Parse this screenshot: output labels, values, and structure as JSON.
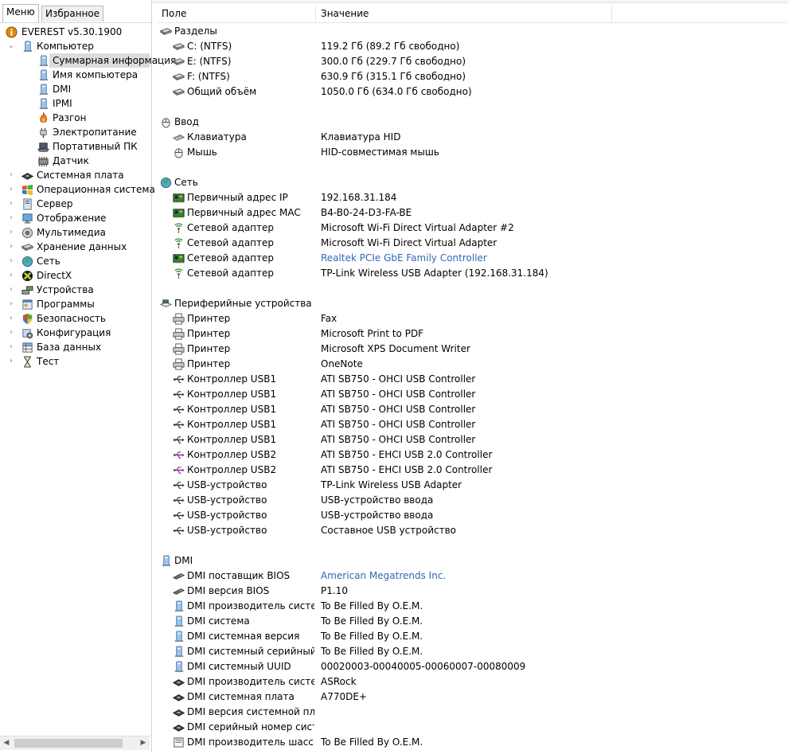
{
  "tabs": {
    "menu": "Меню",
    "favorites": "Избранное"
  },
  "tree": [
    {
      "label": "EVEREST v5.30.1900",
      "level": 0,
      "icon": "info-icon",
      "expander": ""
    },
    {
      "label": "Компьютер",
      "level": 0,
      "icon": "computer-icon",
      "expander": "open"
    },
    {
      "label": "Суммарная информация",
      "level": 1,
      "icon": "computer-icon",
      "expander": "",
      "selected": true
    },
    {
      "label": "Имя компьютера",
      "level": 1,
      "icon": "computer-icon",
      "expander": ""
    },
    {
      "label": "DMI",
      "level": 1,
      "icon": "computer-icon",
      "expander": ""
    },
    {
      "label": "IPMI",
      "level": 1,
      "icon": "computer-icon",
      "expander": ""
    },
    {
      "label": "Разгон",
      "level": 1,
      "icon": "flame-icon",
      "expander": ""
    },
    {
      "label": "Электропитание",
      "level": 1,
      "icon": "power-plug-icon",
      "expander": ""
    },
    {
      "label": "Портативный ПК",
      "level": 1,
      "icon": "laptop-icon",
      "expander": ""
    },
    {
      "label": "Датчик",
      "level": 1,
      "icon": "sensor-icon",
      "expander": ""
    },
    {
      "label": "Системная плата",
      "level": 0,
      "icon": "motherboard-icon",
      "expander": "closed"
    },
    {
      "label": "Операционная система",
      "level": 0,
      "icon": "windows-icon",
      "expander": "closed"
    },
    {
      "label": "Сервер",
      "level": 0,
      "icon": "server-icon",
      "expander": "closed"
    },
    {
      "label": "Отображение",
      "level": 0,
      "icon": "monitor-icon",
      "expander": "closed"
    },
    {
      "label": "Мультимедиа",
      "level": 0,
      "icon": "speaker-icon",
      "expander": "closed"
    },
    {
      "label": "Хранение данных",
      "level": 0,
      "icon": "disk-icon",
      "expander": "closed"
    },
    {
      "label": "Сеть",
      "level": 0,
      "icon": "network-globe-icon",
      "expander": "closed"
    },
    {
      "label": "DirectX",
      "level": 0,
      "icon": "directx-icon",
      "expander": "closed"
    },
    {
      "label": "Устройства",
      "level": 0,
      "icon": "devices-icon",
      "expander": "closed"
    },
    {
      "label": "Программы",
      "level": 0,
      "icon": "programs-icon",
      "expander": "closed"
    },
    {
      "label": "Безопасность",
      "level": 0,
      "icon": "shield-icon",
      "expander": "closed"
    },
    {
      "label": "Конфигурация",
      "level": 0,
      "icon": "config-icon",
      "expander": "closed"
    },
    {
      "label": "База данных",
      "level": 0,
      "icon": "database-icon",
      "expander": "closed"
    },
    {
      "label": "Тест",
      "level": 0,
      "icon": "hourglass-icon",
      "expander": "closed"
    }
  ],
  "columns": {
    "field": "Поле",
    "value": "Значение"
  },
  "rows": [
    {
      "type": "group",
      "field": "Разделы",
      "icon": "disk-group-icon"
    },
    {
      "type": "item",
      "field": "C: (NTFS)",
      "value": "119.2 Гб (89.2 Гб свободно)",
      "icon": "disk-icon"
    },
    {
      "type": "item",
      "field": "E: (NTFS)",
      "value": "300.0 Гб (229.7 Гб свободно)",
      "icon": "disk-icon"
    },
    {
      "type": "item",
      "field": "F: (NTFS)",
      "value": "630.9 Гб (315.1 Гб свободно)",
      "icon": "disk-icon"
    },
    {
      "type": "item",
      "field": "Общий объём",
      "value": "1050.0 Гб (634.0 Гб свободно)",
      "icon": "disk-icon"
    },
    {
      "type": "blank"
    },
    {
      "type": "group",
      "field": "Ввод",
      "icon": "mouse-group-icon"
    },
    {
      "type": "item",
      "field": "Клавиатура",
      "value": "Клавиатура HID",
      "icon": "keyboard-icon"
    },
    {
      "type": "item",
      "field": "Мышь",
      "value": "HID-совместимая мышь",
      "icon": "mouse-icon"
    },
    {
      "type": "blank"
    },
    {
      "type": "group",
      "field": "Сеть",
      "icon": "network-globe-icon"
    },
    {
      "type": "item",
      "field": "Первичный адрес IP",
      "value": "192.168.31.184",
      "icon": "network-card-icon"
    },
    {
      "type": "item",
      "field": "Первичный адрес MAC",
      "value": "B4-B0-24-D3-FA-BE",
      "icon": "network-card-icon"
    },
    {
      "type": "item",
      "field": "Сетевой адаптер",
      "value": "Microsoft Wi-Fi Direct Virtual Adapter #2",
      "icon": "wifi-icon"
    },
    {
      "type": "item",
      "field": "Сетевой адаптер",
      "value": "Microsoft Wi-Fi Direct Virtual Adapter",
      "icon": "wifi-icon"
    },
    {
      "type": "item",
      "field": "Сетевой адаптер",
      "value": "Realtek PCIe GbE Family Controller",
      "icon": "network-card-icon",
      "link": true
    },
    {
      "type": "item",
      "field": "Сетевой адаптер",
      "value": "TP-Link Wireless USB Adapter  (192.168.31.184)",
      "icon": "wifi-icon"
    },
    {
      "type": "blank"
    },
    {
      "type": "group",
      "field": "Периферийные устройства",
      "icon": "peripherals-icon"
    },
    {
      "type": "item",
      "field": "Принтер",
      "value": "Fax",
      "icon": "printer-icon"
    },
    {
      "type": "item",
      "field": "Принтер",
      "value": "Microsoft Print to PDF",
      "icon": "printer-icon"
    },
    {
      "type": "item",
      "field": "Принтер",
      "value": "Microsoft XPS Document Writer",
      "icon": "printer-icon"
    },
    {
      "type": "item",
      "field": "Принтер",
      "value": "OneNote",
      "icon": "printer-icon"
    },
    {
      "type": "item",
      "field": "Контроллер USB1",
      "value": "ATI SB750 - OHCI USB Controller",
      "icon": "usb-icon"
    },
    {
      "type": "item",
      "field": "Контроллер USB1",
      "value": "ATI SB750 - OHCI USB Controller",
      "icon": "usb-icon"
    },
    {
      "type": "item",
      "field": "Контроллер USB1",
      "value": "ATI SB750 - OHCI USB Controller",
      "icon": "usb-icon"
    },
    {
      "type": "item",
      "field": "Контроллер USB1",
      "value": "ATI SB750 - OHCI USB Controller",
      "icon": "usb-icon"
    },
    {
      "type": "item",
      "field": "Контроллер USB1",
      "value": "ATI SB750 - OHCI USB Controller",
      "icon": "usb-icon"
    },
    {
      "type": "item",
      "field": "Контроллер USB2",
      "value": "ATI SB750 - EHCI USB 2.0 Controller",
      "icon": "usb2-icon"
    },
    {
      "type": "item",
      "field": "Контроллер USB2",
      "value": "ATI SB750 - EHCI USB 2.0 Controller",
      "icon": "usb2-icon"
    },
    {
      "type": "item",
      "field": "USB-устройство",
      "value": "TP-Link Wireless USB Adapter",
      "icon": "usb-icon"
    },
    {
      "type": "item",
      "field": "USB-устройство",
      "value": "USB-устройство ввода",
      "icon": "usb-icon"
    },
    {
      "type": "item",
      "field": "USB-устройство",
      "value": "USB-устройство ввода",
      "icon": "usb-icon"
    },
    {
      "type": "item",
      "field": "USB-устройство",
      "value": "Составное USB устройство",
      "icon": "usb-icon"
    },
    {
      "type": "blank"
    },
    {
      "type": "group",
      "field": "DMI",
      "icon": "computer-icon"
    },
    {
      "type": "item",
      "field": "DMI поставщик BIOS",
      "value": "American Megatrends Inc.",
      "icon": "memory-chip-icon",
      "link": true
    },
    {
      "type": "item",
      "field": "DMI версия BIOS",
      "value": "P1.10",
      "icon": "memory-chip-icon"
    },
    {
      "type": "item",
      "field": "DMI производитель системы",
      "value": "To Be Filled By O.E.M.",
      "icon": "computer-icon"
    },
    {
      "type": "item",
      "field": "DMI система",
      "value": "To Be Filled By O.E.M.",
      "icon": "computer-icon"
    },
    {
      "type": "item",
      "field": "DMI системная версия",
      "value": "To Be Filled By O.E.M.",
      "icon": "computer-icon"
    },
    {
      "type": "item",
      "field": "DMI системный серийный ...",
      "value": "To Be Filled By O.E.M.",
      "icon": "computer-icon"
    },
    {
      "type": "item",
      "field": "DMI системный UUID",
      "value": "00020003-00040005-00060007-00080009",
      "icon": "computer-icon"
    },
    {
      "type": "item",
      "field": "DMI производитель систем...",
      "value": "ASRock",
      "icon": "motherboard-icon"
    },
    {
      "type": "item",
      "field": "DMI системная плата",
      "value": "A770DE+",
      "icon": "motherboard-icon"
    },
    {
      "type": "item",
      "field": "DMI версия системной пла...",
      "value": "",
      "icon": "motherboard-icon"
    },
    {
      "type": "item",
      "field": "DMI серийный номер сист...",
      "value": "",
      "icon": "motherboard-icon"
    },
    {
      "type": "item",
      "field": "DMI производитель шасси",
      "value": "To Be Filled By O.E.M.",
      "icon": "chassis-icon"
    }
  ],
  "colors": {
    "link": "#3168b4",
    "selected": "#dcdcdc"
  }
}
